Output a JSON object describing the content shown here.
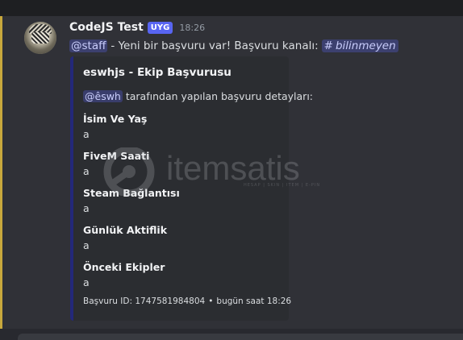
{
  "message": {
    "author": "CodeJS Test",
    "tag": "UYG",
    "time": "18:26",
    "content": {
      "mention": "@staff",
      "text": "- Yeni bir başvuru var! Başvuru kanalı:",
      "channel_hash": "#",
      "channel": "bilinmeyen"
    }
  },
  "embed": {
    "title": "eswhjs - Ekip Başvurusu",
    "desc_mention": "@êswh",
    "desc_text": "tarafından yapılan başvuru detayları:",
    "fields": [
      {
        "name": "İsim Ve Yaş",
        "value": "a"
      },
      {
        "name": "FiveM Saati",
        "value": "a"
      },
      {
        "name": "Steam Bağlantısı",
        "value": "a"
      },
      {
        "name": "Günlük Aktiflik",
        "value": "a"
      },
      {
        "name": "Önceki Ekipler",
        "value": "a"
      }
    ],
    "footer_id": "Başvuru ID: 1747581984804",
    "footer_dot": "•",
    "footer_time": "bugün saat 18:26"
  },
  "watermark": {
    "text": "itemsatis",
    "subtext": "HESAP | SKIN | ITEM | E-PIN"
  },
  "colors": {
    "accent": "#5865f2",
    "mention_stripe": "#c8a83d",
    "embed_border": "#23287a"
  }
}
